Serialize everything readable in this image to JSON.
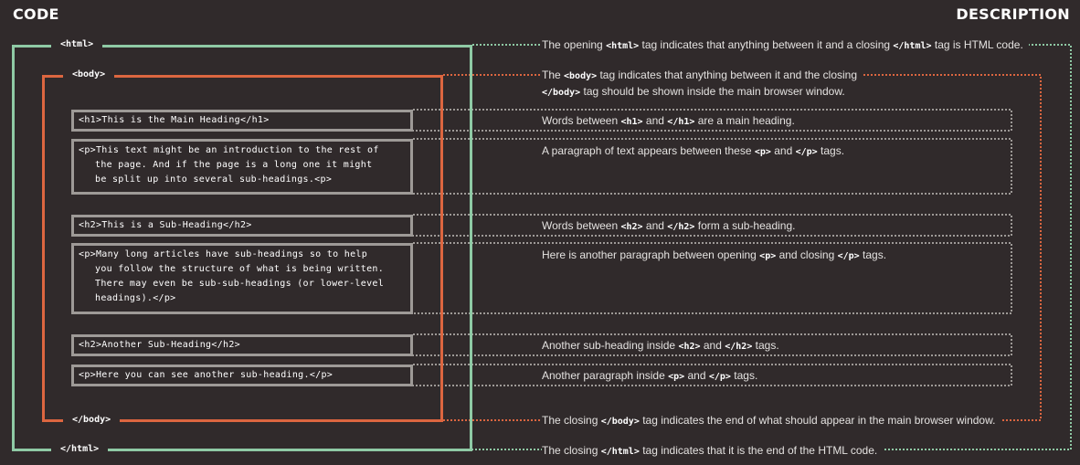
{
  "headers": {
    "code": "CODE",
    "description": "DESCRIPTION"
  },
  "tags": {
    "html_open": "<html>",
    "body_open": "<body>",
    "body_close": "</body>",
    "html_close": "</html>"
  },
  "code_blocks": [
    {
      "lines": [
        "<h1>This is the Main Heading</h1>"
      ]
    },
    {
      "lines": [
        "<p>This text might be an introduction to the rest of",
        "the page. And if the page is a long one it might",
        "be split up into several sub-headings.<p>"
      ]
    },
    {
      "lines": [
        "<h2>This is a Sub-Heading</h2>"
      ]
    },
    {
      "lines": [
        "<p>Many long articles have sub-headings so to help",
        "you follow the structure of what is being written.",
        "There may even be sub-sub-headings (or lower-level",
        "headings).</p>"
      ]
    },
    {
      "lines": [
        "<h2>Another Sub-Heading</h2>"
      ]
    },
    {
      "lines": [
        "<p>Here you can see another sub-heading.</p>"
      ]
    }
  ],
  "descriptions": {
    "html_open": {
      "pre": "The opening ",
      "tag1": "<html>",
      "mid": " tag indicates that anything between it and a closing ",
      "tag2": "</html>",
      "post": " tag is HTML code."
    },
    "body_open": {
      "pre": "The ",
      "tag1": "<body>",
      "mid": " tag indicates that anything between it and the closing",
      "tag2": "</body>",
      "post": " tag should be shown inside the main browser window."
    },
    "h1": {
      "pre": "Words between ",
      "tag1": "<h1>",
      "mid": " and ",
      "tag2": "</h1>",
      "post": " are a main heading."
    },
    "p1": {
      "pre": "A paragraph of text appears between these ",
      "tag1": "<p>",
      "mid": " and ",
      "tag2": "</p>",
      "post": " tags."
    },
    "h2a": {
      "pre": "Words between ",
      "tag1": "<h2>",
      "mid": " and ",
      "tag2": "</h2>",
      "post": " form a sub-heading."
    },
    "p2": {
      "pre": "Here is another paragraph between opening ",
      "tag1": "<p>",
      "mid": " and closing ",
      "tag2": "</p>",
      "post": " tags."
    },
    "h2b": {
      "pre": "Another sub-heading inside ",
      "tag1": "<h2>",
      "mid": " and ",
      "tag2": "</h2>",
      "post": " tags."
    },
    "p3": {
      "pre": "Another paragraph inside ",
      "tag1": "<p>",
      "mid": " and ",
      "tag2": "</p>",
      "post": " tags."
    },
    "body_close": {
      "pre": "The closing ",
      "tag1": "</body>",
      "post": " tag indicates the end of what should appear in the main browser window."
    },
    "html_close": {
      "pre": "The closing ",
      "tag1": "</html>",
      "post": " tag indicates that it is the end of the HTML code."
    }
  },
  "colors": {
    "background": "#302a2b",
    "html_outline": "#8fcaa5",
    "body_outline": "#dc6640",
    "element_outline": "#9e9a97",
    "text": "#ffffff"
  }
}
